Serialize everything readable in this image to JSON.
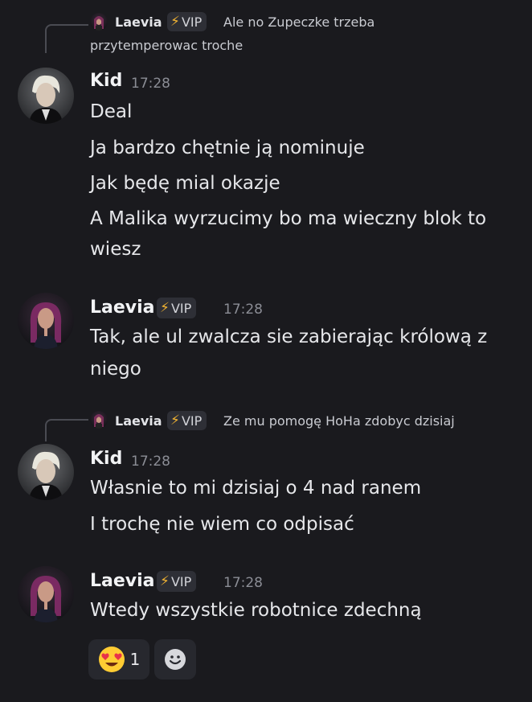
{
  "colors": {
    "background": "#1a1a1e",
    "vip_bolt": "#f0b232",
    "reaction_bg": "#27282e"
  },
  "messages": [
    {
      "reply": {
        "author": "Laevia",
        "badge": "VIP",
        "text_line1": "Ale no Zupeczke trzeba",
        "text_line2": "przytemperowac troche"
      },
      "author": "Kid",
      "time": "17:28",
      "lines": [
        "Deal",
        "Ja bardzo chętnie ją nominuje",
        "Jak będę mial okazje",
        "A Malika wyrzucimy bo ma wieczny blok to",
        "wiesz"
      ]
    },
    {
      "author": "Laevia",
      "badge": "VIP",
      "time": "17:28",
      "lines": [
        "Tak, ale ul zwalcza sie zabierając królową z",
        "niego"
      ]
    },
    {
      "reply": {
        "author": "Laevia",
        "badge": "VIP",
        "text": "Ze mu pomogę HoHa zdobyc dzisiaj"
      },
      "author": "Kid",
      "time": "17:28",
      "lines": [
        "Własnie to mi dzisiaj o 4 nad ranem",
        "I trochę nie wiem co odpisać"
      ]
    },
    {
      "author": "Laevia",
      "badge": "VIP",
      "time": "17:28",
      "lines": [
        "Wtedy wszystkie robotnice zdechną"
      ],
      "reactions": [
        {
          "icon": "heart-eyes-emoji",
          "count": "1"
        }
      ],
      "add_reaction_icon": "add-reaction-icon"
    }
  ]
}
